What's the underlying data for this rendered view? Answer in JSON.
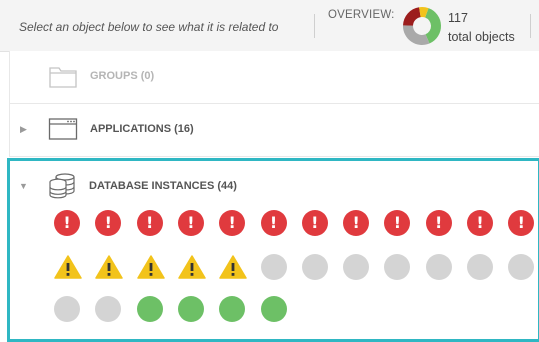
{
  "header": {
    "hint": "Select an object below to see what it is related to",
    "overview_label": "OVERVIEW:",
    "total_count": "117",
    "total_text": "total objects",
    "donut": [
      {
        "status": "ok",
        "color": "#6dc066",
        "fraction": 0.38
      },
      {
        "status": "unknown",
        "color": "#a9a9a9",
        "fraction": 0.32
      },
      {
        "status": "critical",
        "color": "#9c1d1d",
        "fraction": 0.22
      },
      {
        "status": "warning",
        "color": "#f2c31b",
        "fraction": 0.08
      }
    ]
  },
  "rows": {
    "groups": {
      "label": "GROUPS (0)",
      "icon": "folder-icon"
    },
    "applications": {
      "label": "APPLICATIONS (16)",
      "icon": "application-window-icon"
    },
    "database_instances": {
      "label": "DATABASE INSTANCES (44)",
      "icon": "database-icon"
    }
  },
  "statuses": [
    [
      "critical",
      "critical",
      "critical",
      "critical",
      "critical",
      "critical",
      "critical",
      "critical",
      "critical",
      "critical",
      "critical",
      "critical"
    ],
    [
      "warning",
      "warning",
      "warning",
      "warning",
      "warning",
      "unknown",
      "unknown",
      "unknown",
      "unknown",
      "unknown",
      "unknown",
      "unknown"
    ],
    [
      "unknown",
      "unknown",
      "ok",
      "ok",
      "ok",
      "ok"
    ]
  ],
  "colors": {
    "accent": "#2fb7c3",
    "critical": "#e03a3e",
    "warning": "#f2c31b",
    "ok": "#6dc066",
    "unknown": "#d4d4d4"
  }
}
